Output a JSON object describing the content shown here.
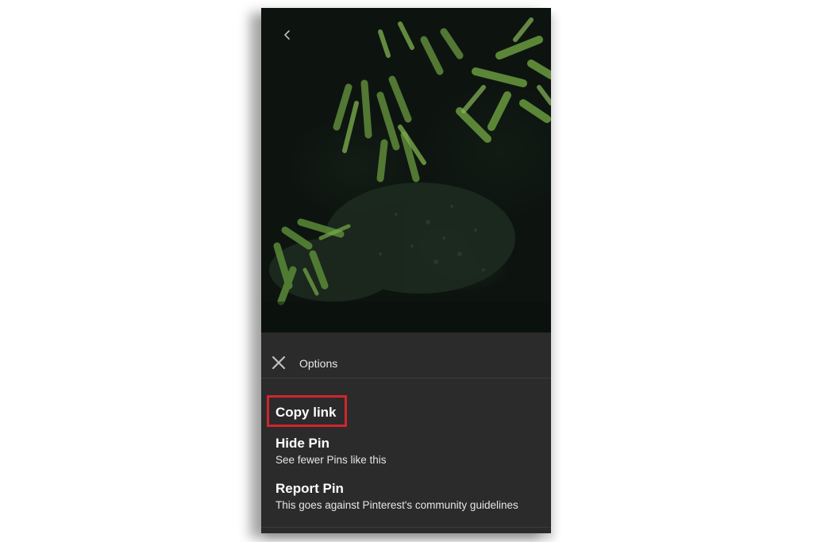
{
  "sheet": {
    "title": "Options",
    "close_icon": "close-icon"
  },
  "nav": {
    "back_icon": "chevron-left-icon"
  },
  "options": [
    {
      "label": "Copy link",
      "sub": ""
    },
    {
      "label": "Hide Pin",
      "sub": "See fewer Pins like this"
    },
    {
      "label": "Report Pin",
      "sub": "This goes against Pinterest's community guidelines"
    }
  ],
  "highlight": {
    "target": "Copy link",
    "color": "#d0252b"
  },
  "colors": {
    "sheet_bg": "#2b2b2b",
    "text": "#ffffff",
    "image_bg": "#0d1410"
  }
}
